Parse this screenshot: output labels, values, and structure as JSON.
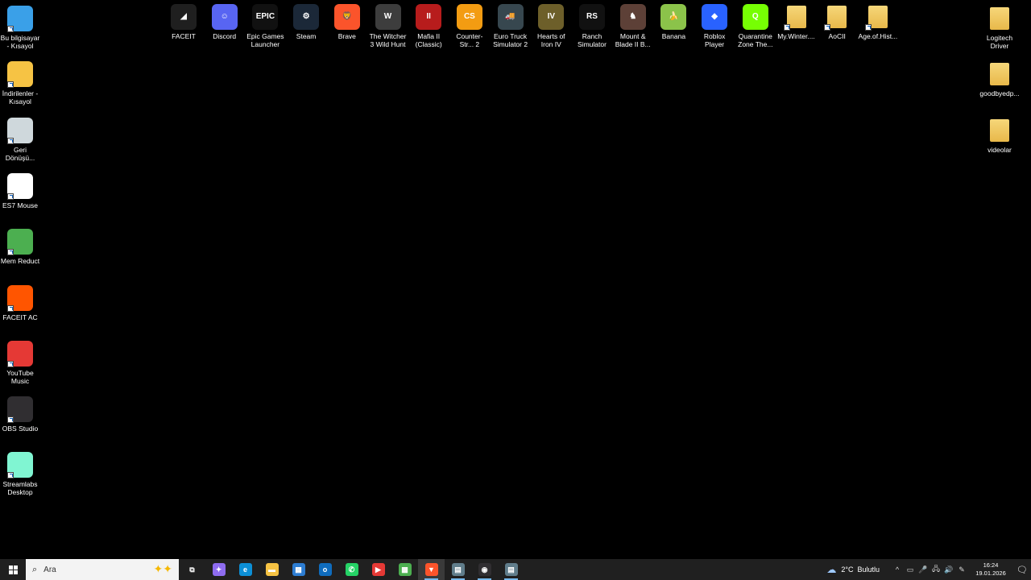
{
  "desktop": {
    "icons_left": [
      {
        "label": "Bu bilgisayar - Kısayol",
        "icon": "computer-icon",
        "color": "#3aa0e8"
      },
      {
        "label": "İndirilenler - Kısayol",
        "icon": "downloads-folder-icon",
        "color": "#f6c344"
      },
      {
        "label": "Geri Dönüşü...",
        "icon": "recycle-bin-icon",
        "color": "#cfd8dc"
      },
      {
        "label": "ES7 Mouse",
        "icon": "shuriken-icon",
        "color": "#ffffff"
      },
      {
        "label": "Mem Reduct",
        "icon": "memory-chip-icon",
        "color": "#4caf50"
      },
      {
        "label": "FACEIT AC",
        "icon": "faceit-ac-icon",
        "color": "#ff5500"
      },
      {
        "label": "YouTube Music",
        "icon": "youtube-music-icon",
        "color": "#e53935"
      },
      {
        "label": "OBS Studio",
        "icon": "obs-icon",
        "color": "#302e31"
      },
      {
        "label": "Streamlabs Desktop",
        "icon": "streamlabs-icon",
        "color": "#80f5d2"
      }
    ],
    "icons_top": [
      {
        "label": "FACEIT",
        "icon": "faceit-icon",
        "color": "#1f1f1f",
        "accent": "#ff5500",
        "glyph": "◢"
      },
      {
        "label": "Discord",
        "icon": "discord-icon",
        "color": "#5865f2",
        "glyph": "☺"
      },
      {
        "label": "Epic Games Launcher",
        "icon": "epic-games-icon",
        "color": "#111111",
        "glyph": "EPIC"
      },
      {
        "label": "Steam",
        "icon": "steam-icon",
        "color": "#1b2838",
        "glyph": "⚙"
      },
      {
        "label": "Brave",
        "icon": "brave-icon",
        "color": "#fb542b",
        "glyph": "🦁"
      },
      {
        "label": "The Witcher 3 Wild Hunt",
        "icon": "witcher-icon",
        "color": "#3d3d3d",
        "glyph": "W"
      },
      {
        "label": "Mafia II (Classic)",
        "icon": "mafia-icon",
        "color": "#b71c1c",
        "glyph": "II"
      },
      {
        "label": "Counter-Str... 2",
        "icon": "cs2-icon",
        "color": "#f39c12",
        "glyph": "CS"
      },
      {
        "label": "Euro Truck Simulator 2",
        "icon": "truck-icon",
        "color": "#37474f",
        "glyph": "🚚"
      },
      {
        "label": "Hearts of Iron IV",
        "icon": "hoi4-icon",
        "color": "#6d5f2a",
        "glyph": "IV"
      },
      {
        "label": "Ranch Simulator",
        "icon": "ranch-icon",
        "color": "#111111",
        "glyph": "RS"
      },
      {
        "label": "Mount & Blade II B...",
        "icon": "horse-icon",
        "color": "#5d4037",
        "glyph": "♞"
      },
      {
        "label": "Banana",
        "icon": "banana-icon",
        "color": "#8bc34a",
        "glyph": "🍌"
      },
      {
        "label": "Roblox Player",
        "icon": "roblox-icon",
        "color": "#2962ff",
        "glyph": "◆"
      },
      {
        "label": "Quarantine Zone The...",
        "icon": "quarantine-icon",
        "color": "#76ff03",
        "glyph": "Q"
      },
      {
        "label": "My.Winter....",
        "icon": "folder-icon",
        "color": "#f6d77a",
        "glyph": ""
      },
      {
        "label": "AoCII",
        "icon": "folder-icon",
        "color": "#f6d77a",
        "glyph": ""
      },
      {
        "label": "Age.of.Hist...",
        "icon": "folder-icon",
        "color": "#f6d77a",
        "glyph": ""
      }
    ],
    "icons_right": [
      {
        "label": "Logitech Driver",
        "icon": "folder-icon"
      },
      {
        "label": "goodbyedp...",
        "icon": "folder-icon"
      },
      {
        "label": "videolar",
        "icon": "folder-icon"
      }
    ]
  },
  "taskbar": {
    "search_placeholder": "Ara",
    "apps": [
      {
        "name": "task-view-icon",
        "glyph": "⧉",
        "color": "#202020"
      },
      {
        "name": "copilot-icon",
        "glyph": "✦",
        "color": "#8e6cf0"
      },
      {
        "name": "edge-icon",
        "glyph": "e",
        "color": "#0c8fd6"
      },
      {
        "name": "file-explorer-icon",
        "glyph": "▬",
        "color": "#f6c344"
      },
      {
        "name": "store-icon",
        "glyph": "▦",
        "color": "#2d7dd2"
      },
      {
        "name": "outlook-icon",
        "glyph": "o",
        "color": "#0f6cbd"
      },
      {
        "name": "whatsapp-icon",
        "glyph": "✆",
        "color": "#25d366"
      },
      {
        "name": "youtube-music-icon",
        "glyph": "▶",
        "color": "#e53935"
      },
      {
        "name": "minecraft-icon",
        "glyph": "▩",
        "color": "#4caf50"
      },
      {
        "name": "brave-icon",
        "glyph": "▼",
        "color": "#fb542b"
      },
      {
        "name": "app-window-icon",
        "glyph": "▤",
        "color": "#607d8b"
      },
      {
        "name": "obs-icon",
        "glyph": "◉",
        "color": "#302e31"
      },
      {
        "name": "app-window-icon-2",
        "glyph": "▤",
        "color": "#607d8b"
      }
    ],
    "weather": {
      "temp": "2°C",
      "desc": "Bulutlu"
    },
    "clock": {
      "time": "16:24",
      "date": "19.01.2026"
    },
    "tray_icons": [
      "^",
      "▭",
      "🎤",
      "🖧",
      "🔊",
      "✎"
    ]
  }
}
